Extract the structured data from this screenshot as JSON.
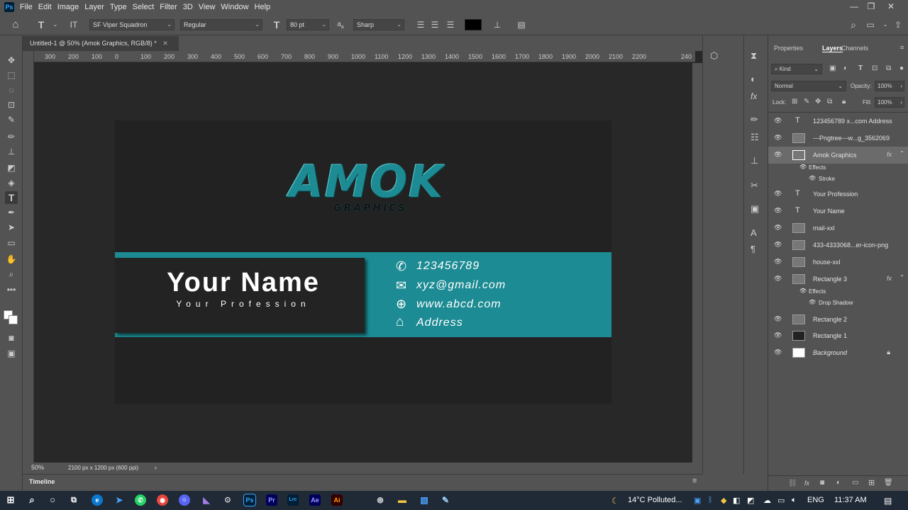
{
  "app": {
    "logo": "Ps"
  },
  "menu": [
    "File",
    "Edit",
    "Image",
    "Layer",
    "Type",
    "Select",
    "Filter",
    "3D",
    "View",
    "Window",
    "Help"
  ],
  "options": {
    "font_family": "SF Viper Squadron",
    "font_style": "Regular",
    "font_size": "80 pt",
    "antialias": "Sharp",
    "aa_label": "a",
    "aa_sub": "a"
  },
  "document": {
    "tab_title": "Untitled-1 @ 50% (Amok Graphics, RGB/8) *",
    "zoom": "50%",
    "doc_size": "2100 px x 1200 px (600 ppi)",
    "ruler_ticks": [
      "300",
      "200",
      "100",
      "0",
      "100",
      "200",
      "300",
      "400",
      "500",
      "600",
      "700",
      "800",
      "900",
      "1000",
      "1100",
      "1200",
      "1300",
      "1400",
      "1500",
      "1600",
      "1700",
      "1800",
      "1900",
      "2000",
      "2100",
      "2200",
      "240"
    ]
  },
  "card": {
    "logo_text": "AMOK",
    "logo_sub": "GRAPHICS",
    "name": "Your Name",
    "profession": "Your Profession",
    "phone": "123456789",
    "email": "xyz@gmail.com",
    "website": "www.abcd.com",
    "address": "Address",
    "accent_color": "#1c8b93",
    "dark_color": "#222222"
  },
  "panels": {
    "tabs": [
      "Properties",
      "Layers",
      "Channels"
    ],
    "active_tab": "Layers",
    "filter_kind": "Kind",
    "blend_mode": "Normal",
    "opacity_label": "Opacity:",
    "opacity": "100%",
    "lock_label": "Lock:",
    "fill_label": "Fill:",
    "fill": "100%"
  },
  "layers": [
    {
      "name": "123456789 x...com Address",
      "kind": "text"
    },
    {
      "name": "---Pngtree---w...g_3562069",
      "kind": "image"
    },
    {
      "name": "Amok Graphics",
      "kind": "image",
      "fx": "fx",
      "selected": true
    },
    {
      "name": "Effects",
      "kind": "effects"
    },
    {
      "name": "Stroke",
      "kind": "effect"
    },
    {
      "name": "Your Profession",
      "kind": "text"
    },
    {
      "name": "Your Name",
      "kind": "text"
    },
    {
      "name": "mail-xxl",
      "kind": "image"
    },
    {
      "name": "433-4333068...er-icon-png",
      "kind": "image"
    },
    {
      "name": "house-xxl",
      "kind": "image"
    },
    {
      "name": "Rectangle 3",
      "kind": "shape",
      "fx": "fx"
    },
    {
      "name": "Effects",
      "kind": "effects"
    },
    {
      "name": "Drop Shadow",
      "kind": "effect"
    },
    {
      "name": "Rectangle 2",
      "kind": "shape"
    },
    {
      "name": "Rectangle 1",
      "kind": "shape"
    },
    {
      "name": "Background",
      "kind": "background"
    }
  ],
  "timeline": {
    "label": "Timeline"
  },
  "taskbar": {
    "weather": "14°C  Polluted...",
    "lang": "ENG",
    "time": "11:37 AM",
    "apps": [
      "Pr",
      "Lrc",
      "Ae",
      "Ai"
    ]
  }
}
